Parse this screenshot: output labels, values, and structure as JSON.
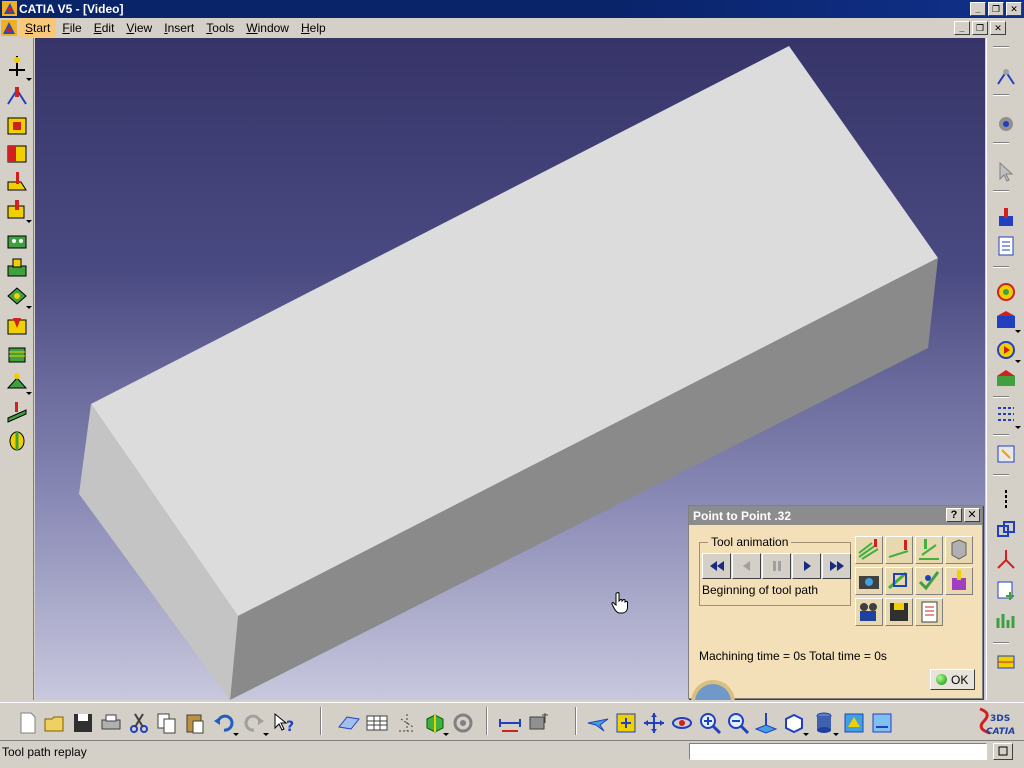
{
  "window": {
    "title": "CATIA V5 - [Video]",
    "minimize_glyph": "_",
    "restore_glyph": "❐",
    "close_glyph": "✕"
  },
  "menu": {
    "items": [
      {
        "label": "Start",
        "key": "S"
      },
      {
        "label": "File",
        "key": "F"
      },
      {
        "label": "Edit",
        "key": "E"
      },
      {
        "label": "View",
        "key": "V"
      },
      {
        "label": "Insert",
        "key": "I"
      },
      {
        "label": "Tools",
        "key": "T"
      },
      {
        "label": "Window",
        "key": "W"
      },
      {
        "label": "Help",
        "key": "H"
      }
    ],
    "active_color": "#f8c878"
  },
  "dialog": {
    "title": "Point to Point .32",
    "help_glyph": "?",
    "close_glyph": "✕",
    "group_label": "Tool animation",
    "animation_status": "Beginning of tool path",
    "machining_time": "Machining time = 0s   Total time = 0s",
    "ok_label": "OK"
  },
  "status": {
    "text": "Tool path replay",
    "command_value": ""
  },
  "branding": {
    "logo_text": "CATIA",
    "ds_letters": "3DS"
  },
  "colors": {
    "titlebar": "#0a246a",
    "viewport_top": "#363468",
    "viewport_bottom": "#c8c8de",
    "part_top": "#dcdcdc",
    "part_front": "#8a8a8a",
    "part_side": "#c4c4c4",
    "dialog_bg": "#f3e0b8"
  }
}
